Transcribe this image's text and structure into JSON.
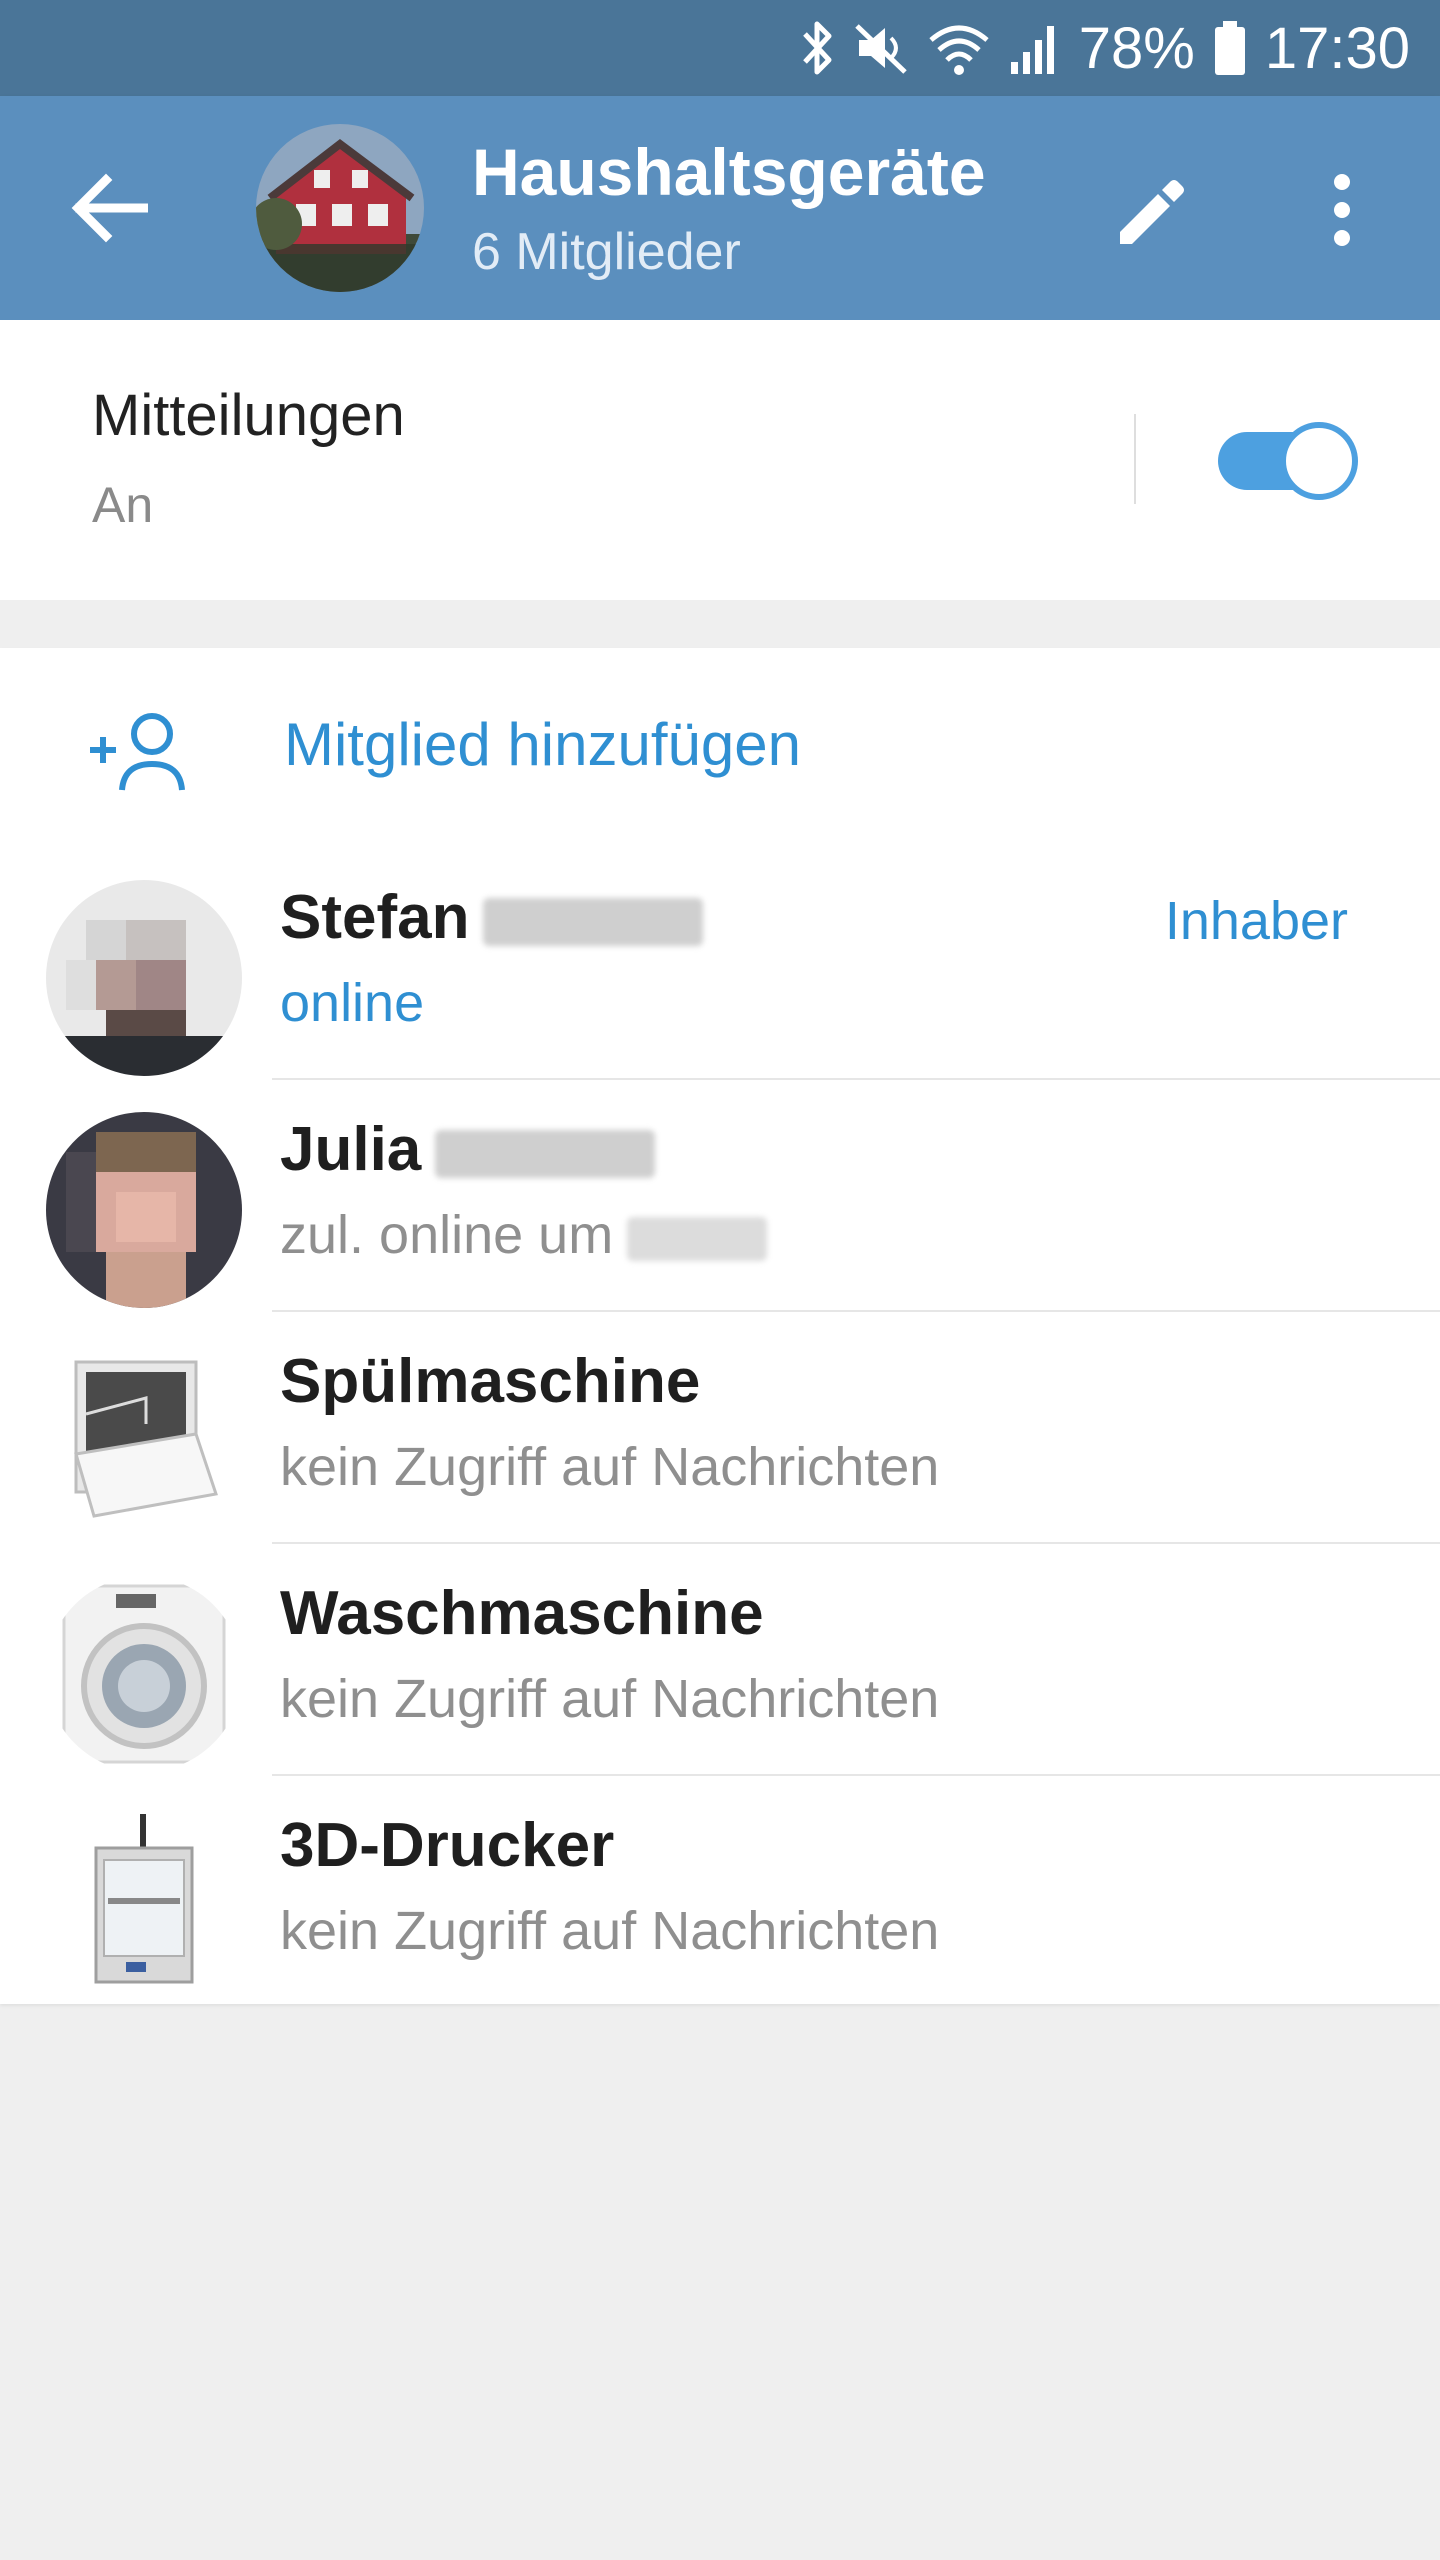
{
  "status_bar": {
    "battery": "78%",
    "time": "17:30",
    "icons": [
      "bluetooth-icon",
      "mute-icon",
      "wifi-icon",
      "signal-icon",
      "battery-icon"
    ]
  },
  "header": {
    "title": "Haushaltsgeräte",
    "subtitle": "6 Mitglieder",
    "colors": {
      "status_bar": "#4a7598",
      "app_bar": "#5b8fbe"
    },
    "icons": [
      "back-arrow-icon",
      "pencil-icon",
      "more-vert-icon"
    ]
  },
  "notifications": {
    "title": "Mitteilungen",
    "status": "An",
    "enabled": true
  },
  "add_member": {
    "label": "Mitglied hinzufügen",
    "icon": "add-person-icon"
  },
  "members": [
    {
      "name": "Stefan",
      "status": "online",
      "role": "Inhaber",
      "online": true
    },
    {
      "name": "Julia",
      "status": "zul. online um",
      "role": "",
      "online": false
    },
    {
      "name": "Spülmaschine",
      "status": "kein Zugriff auf Nachrichten",
      "role": "",
      "online": false
    },
    {
      "name": "Waschmaschine",
      "status": "kein Zugriff auf Nachrichten",
      "role": "",
      "online": false
    },
    {
      "name": "3D-Drucker",
      "status": "kein Zugriff auf Nachrichten",
      "role": "",
      "online": false
    }
  ],
  "accent_color": "#2f8fd2"
}
